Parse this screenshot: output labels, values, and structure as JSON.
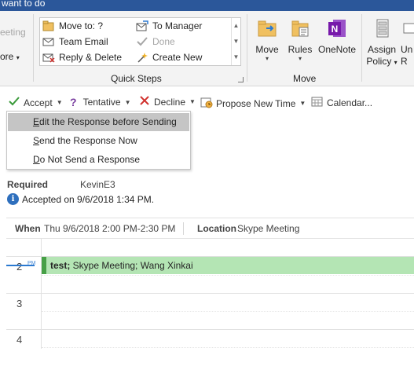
{
  "titlebar": {
    "text": "want to do"
  },
  "ribbon": {
    "left": {
      "meeting_label": "eeting",
      "more_label": "ore"
    },
    "quick_steps": {
      "group_label": "Quick Steps",
      "items": [
        {
          "label": "Move to: ?",
          "icon": "move-to-icon",
          "disabled": false
        },
        {
          "label": "To Manager",
          "icon": "to-manager-icon",
          "disabled": false
        },
        {
          "label": "Team Email",
          "icon": "team-email-icon",
          "disabled": false
        },
        {
          "label": "Done",
          "icon": "done-check-icon",
          "disabled": true
        },
        {
          "label": "Reply & Delete",
          "icon": "reply-delete-icon",
          "disabled": false
        },
        {
          "label": "Create New",
          "icon": "create-new-icon",
          "disabled": false
        }
      ]
    },
    "move_group": {
      "group_label": "Move",
      "buttons": [
        {
          "label": "Move",
          "icon": "folder-move-icon"
        },
        {
          "label": "Rules",
          "icon": "rules-icon"
        },
        {
          "label": "OneNote",
          "icon": "onenote-icon"
        }
      ]
    },
    "policy": {
      "label_line1": "Assign",
      "label_line2": "Policy"
    },
    "cut_button": {
      "label_line1": "Un",
      "label_line2": "R"
    }
  },
  "response_bar": {
    "accept": "Accept",
    "tentative": "Tentative",
    "decline": "Decline",
    "propose": "Propose New Time",
    "calendar": "Calendar..."
  },
  "accept_menu": {
    "items": [
      {
        "accel": "E",
        "rest": "dit the Response before Sending",
        "highlighted": true
      },
      {
        "accel": "S",
        "rest": "end the Response Now",
        "highlighted": false
      },
      {
        "accel": "D",
        "rest": "o Not Send a Response",
        "highlighted": false
      }
    ]
  },
  "meeting": {
    "required_label": "Required",
    "required_value": "KevinE3",
    "accepted_text": "Accepted on 9/6/2018 1:34 PM.",
    "when_label": "When",
    "when_value": "Thu 9/6/2018 2:00 PM-2:30 PM",
    "location_label": "Location",
    "location_value": "Skype Meeting"
  },
  "calendar": {
    "hours": [
      "2",
      "3",
      "4"
    ],
    "time_marker": "PM",
    "event_title": "test;",
    "event_rest": " Skype Meeting; Wang Xinkai"
  },
  "colors": {
    "accent": "#2b579a",
    "event_fill": "#b4e5b4",
    "event_border": "#46a046",
    "accept_green": "#3a9a3a",
    "decline_red": "#d0312d",
    "tentative_purple": "#7a3fa0",
    "onenote_purple": "#7719aa"
  }
}
